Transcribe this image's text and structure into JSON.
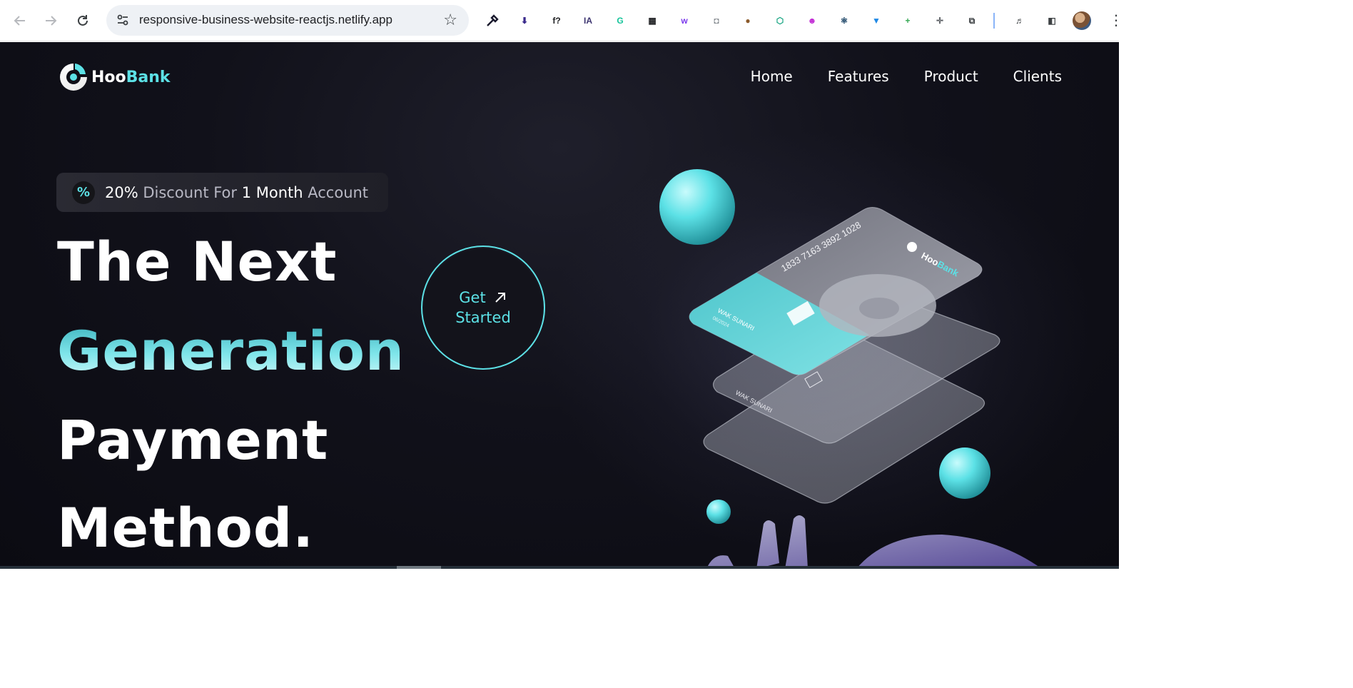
{
  "browser": {
    "url": "responsive-business-website-reactjs.netlify.app",
    "extensions": [
      {
        "name": "color-picker-icon",
        "glyph": "",
        "color": "#1a1a2e"
      },
      {
        "name": "download-icon",
        "glyph": "⬇",
        "color": "#3a2a8c"
      },
      {
        "name": "formula-icon",
        "glyph": "f?",
        "color": "#202124"
      },
      {
        "name": "ia-icon",
        "glyph": "IA",
        "color": "#3c3470"
      },
      {
        "name": "grammarly-icon",
        "glyph": "G",
        "color": "#15c39a"
      },
      {
        "name": "qr-code-icon",
        "glyph": "▦",
        "color": "#202124"
      },
      {
        "name": "purple-w-icon",
        "glyph": "w",
        "color": "#7c3aed"
      },
      {
        "name": "camera-icon",
        "glyph": "◘",
        "color": "#80868b"
      },
      {
        "name": "cookie-icon",
        "glyph": "●",
        "color": "#8b5a2b"
      },
      {
        "name": "hexagon-icon",
        "glyph": "⬡",
        "color": "#12a37f"
      },
      {
        "name": "bot-icon",
        "glyph": "☻",
        "color": "#c026d3"
      },
      {
        "name": "react-devtools-icon",
        "glyph": "⚛",
        "color": "#0f3b5f"
      },
      {
        "name": "shield-icon",
        "glyph": "▼",
        "color": "#1e88e5"
      },
      {
        "name": "plus-icon",
        "glyph": "+",
        "color": "#34a853"
      },
      {
        "name": "move-icon",
        "glyph": "✛",
        "color": "#5f6368"
      },
      {
        "name": "puzzle-icon",
        "glyph": "⧉",
        "color": "#3c4043"
      },
      {
        "name": "media-icon",
        "glyph": "♬",
        "color": "#3c4043"
      },
      {
        "name": "side-panel-icon",
        "glyph": "◧",
        "color": "#3c4043"
      }
    ],
    "accent_color": "#5ce1e6"
  },
  "site": {
    "logo_prefix": "Hoo",
    "logo_accent": "Bank",
    "nav": [
      "Home",
      "Features",
      "Product",
      "Clients"
    ],
    "discount": {
      "percent": "20%",
      "text1": " Discount For ",
      "duration": "1 Month",
      "text2": " Account"
    },
    "hero_lines": [
      "The Next",
      "Generation",
      "Payment",
      "Method."
    ],
    "cta_line1": "Get",
    "cta_line2": "Started",
    "card": {
      "number": "1833 7163 3892 1028",
      "holder": "WAK SUNARI",
      "expiry": "06/2024",
      "brand_prefix": "Hoo",
      "brand_accent": "Bank"
    },
    "colors": {
      "background": "#11111a",
      "accent": "#5ce1e6",
      "text": "#ffffff"
    }
  }
}
